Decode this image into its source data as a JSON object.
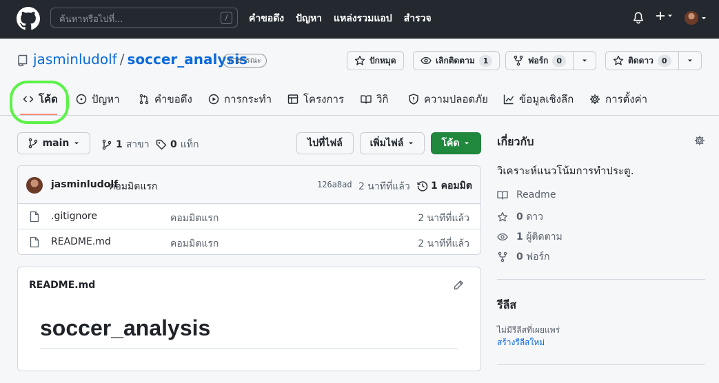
{
  "header": {
    "search_placeholder": "ค้นหาหรือไปที่...",
    "search_shortcut": "/",
    "nav": [
      "คำขอดึง",
      "ปัญหา",
      "แหล่งรวมแอป",
      "สำรวจ"
    ]
  },
  "repo": {
    "owner": "jasminludolf",
    "separator": "/",
    "name": "soccer_analysis",
    "visibility": "สาธารณะ",
    "pin_label": "ปักหมุด",
    "watch_label": "เลิกติดตาม",
    "watch_count": "1",
    "fork_label": "ฟอร์ก",
    "fork_count": "0",
    "star_label": "ติดดาว",
    "star_count": "0"
  },
  "tabs": [
    "โค้ด",
    "ปัญหา",
    "คำขอดึง",
    "การกระทำ",
    "โครงการ",
    "วิกิ",
    "ความปลอดภัย",
    "ข้อมูลเชิงลึก",
    "การตั้งค่า"
  ],
  "toolbar": {
    "branch": "main",
    "branch_count": "1",
    "branch_label": "สาขา",
    "tag_count": "0",
    "tag_label": "แท็ก",
    "goto_file": "ไปที่ไฟล์",
    "add_file": "เพิ่มไฟล์",
    "code": "โค้ด"
  },
  "commit": {
    "author": "jasminludolf",
    "message": "คอมมิตแรก",
    "hash": "126a8ad",
    "time": "2 นาทีที่แล้ว",
    "count_label": "1 คอมมิต"
  },
  "files": [
    {
      "name": ".gitignore",
      "message": "คอมมิตแรก",
      "time": "2 นาทีที่แล้ว"
    },
    {
      "name": "README.md",
      "message": "คอมมิตแรก",
      "time": "2 นาทีที่แล้ว"
    }
  ],
  "readme": {
    "file": "README.md",
    "heading": "soccer_analysis"
  },
  "about": {
    "title": "เกี่ยวกับ",
    "description": "วิเคราะห์แนวโน้มการทำประตู.",
    "readme_label": "Readme",
    "stars_count": "0",
    "stars_label": "ดาว",
    "watchers_count": "1",
    "watchers_label": "ผู้ติดตาม",
    "forks_count": "0",
    "forks_label": "ฟอร์ก"
  },
  "releases": {
    "title": "รีลีส",
    "none_text": "ไม่มีรีลีสที่เผยแพร่",
    "create_link": "สร้างรีลีสใหม่"
  },
  "colors": {
    "header_bg": "#24292f",
    "link": "#0969da",
    "primary_button": "#1f883d",
    "tab_underline": "#fd8c73",
    "highlight_ring": "#5cf248"
  }
}
